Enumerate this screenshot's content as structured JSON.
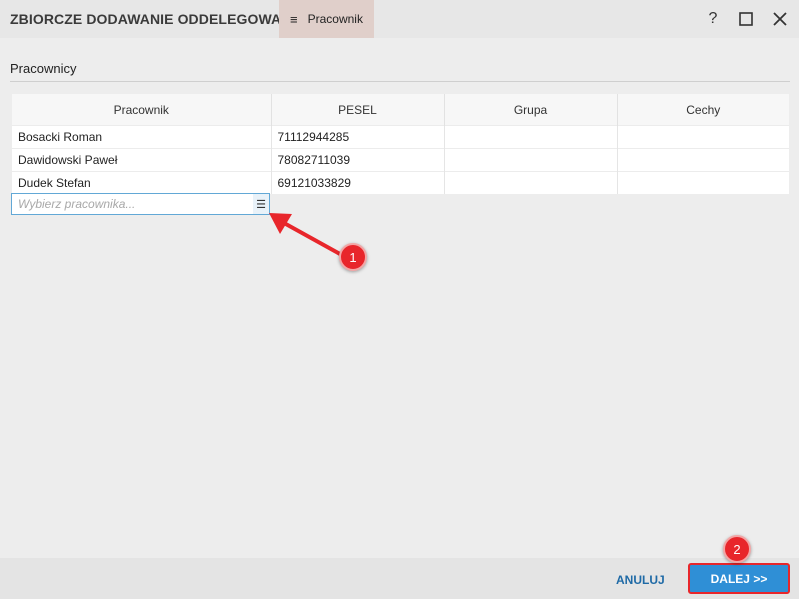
{
  "window": {
    "title": "ZBIORCZE DODAWANIE ODDELEGOWAŃ",
    "tab_icon": "menu-icon",
    "tab_label": "Pracownik",
    "controls": {
      "help": "?",
      "maximize": "☐",
      "close": "✕"
    }
  },
  "section": {
    "label": "Pracownicy"
  },
  "table": {
    "columns": [
      "Pracownik",
      "PESEL",
      "Grupa",
      "Cechy"
    ],
    "rows": [
      {
        "pracownik": "Bosacki Roman",
        "pesel": "71112944285",
        "grupa": "",
        "cechy": ""
      },
      {
        "pracownik": "Dawidowski Paweł",
        "pesel": "78082711039",
        "grupa": "",
        "cechy": ""
      },
      {
        "pracownik": "Dudek Stefan",
        "pesel": "69121033829",
        "grupa": "",
        "cechy": ""
      }
    ]
  },
  "picker": {
    "placeholder": "Wybierz pracownika...",
    "icon": "list-icon"
  },
  "annotations": {
    "marker_1": "1",
    "marker_2": "2"
  },
  "footer": {
    "cancel_label": "ANULUJ",
    "next_label": "DALEJ >>"
  },
  "colors": {
    "accent": "#2f8fd6",
    "annotation_red": "#e8262b",
    "tab_bg": "#e0cfca"
  }
}
